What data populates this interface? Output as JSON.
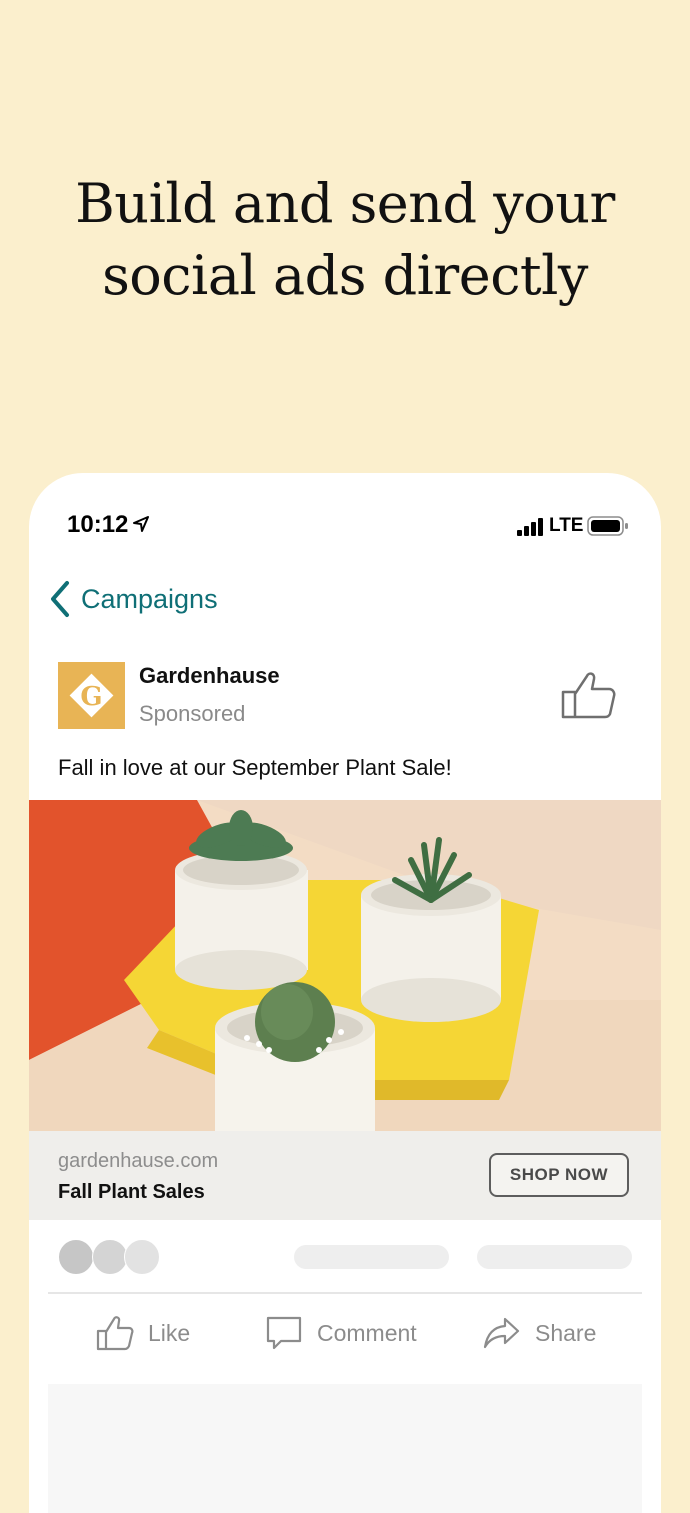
{
  "headline": {
    "line1": "Build and send your",
    "line2": "social ads directly"
  },
  "status_bar": {
    "time": "10:12",
    "network": "LTE"
  },
  "nav": {
    "back_label": "Campaigns"
  },
  "post": {
    "brand_name": "Gardenhause",
    "sponsored_label": "Sponsored",
    "logo_letter": "G",
    "text": "Fall in love at our September Plant Sale!",
    "link_domain": "gardenhause.com",
    "link_title": "Fall Plant Sales",
    "cta_label": "SHOP NOW"
  },
  "actions": {
    "like": "Like",
    "comment": "Comment",
    "share": "Share"
  },
  "colors": {
    "background": "#fbefcd",
    "accent": "#0f6f76",
    "logo": "#e8b455"
  }
}
